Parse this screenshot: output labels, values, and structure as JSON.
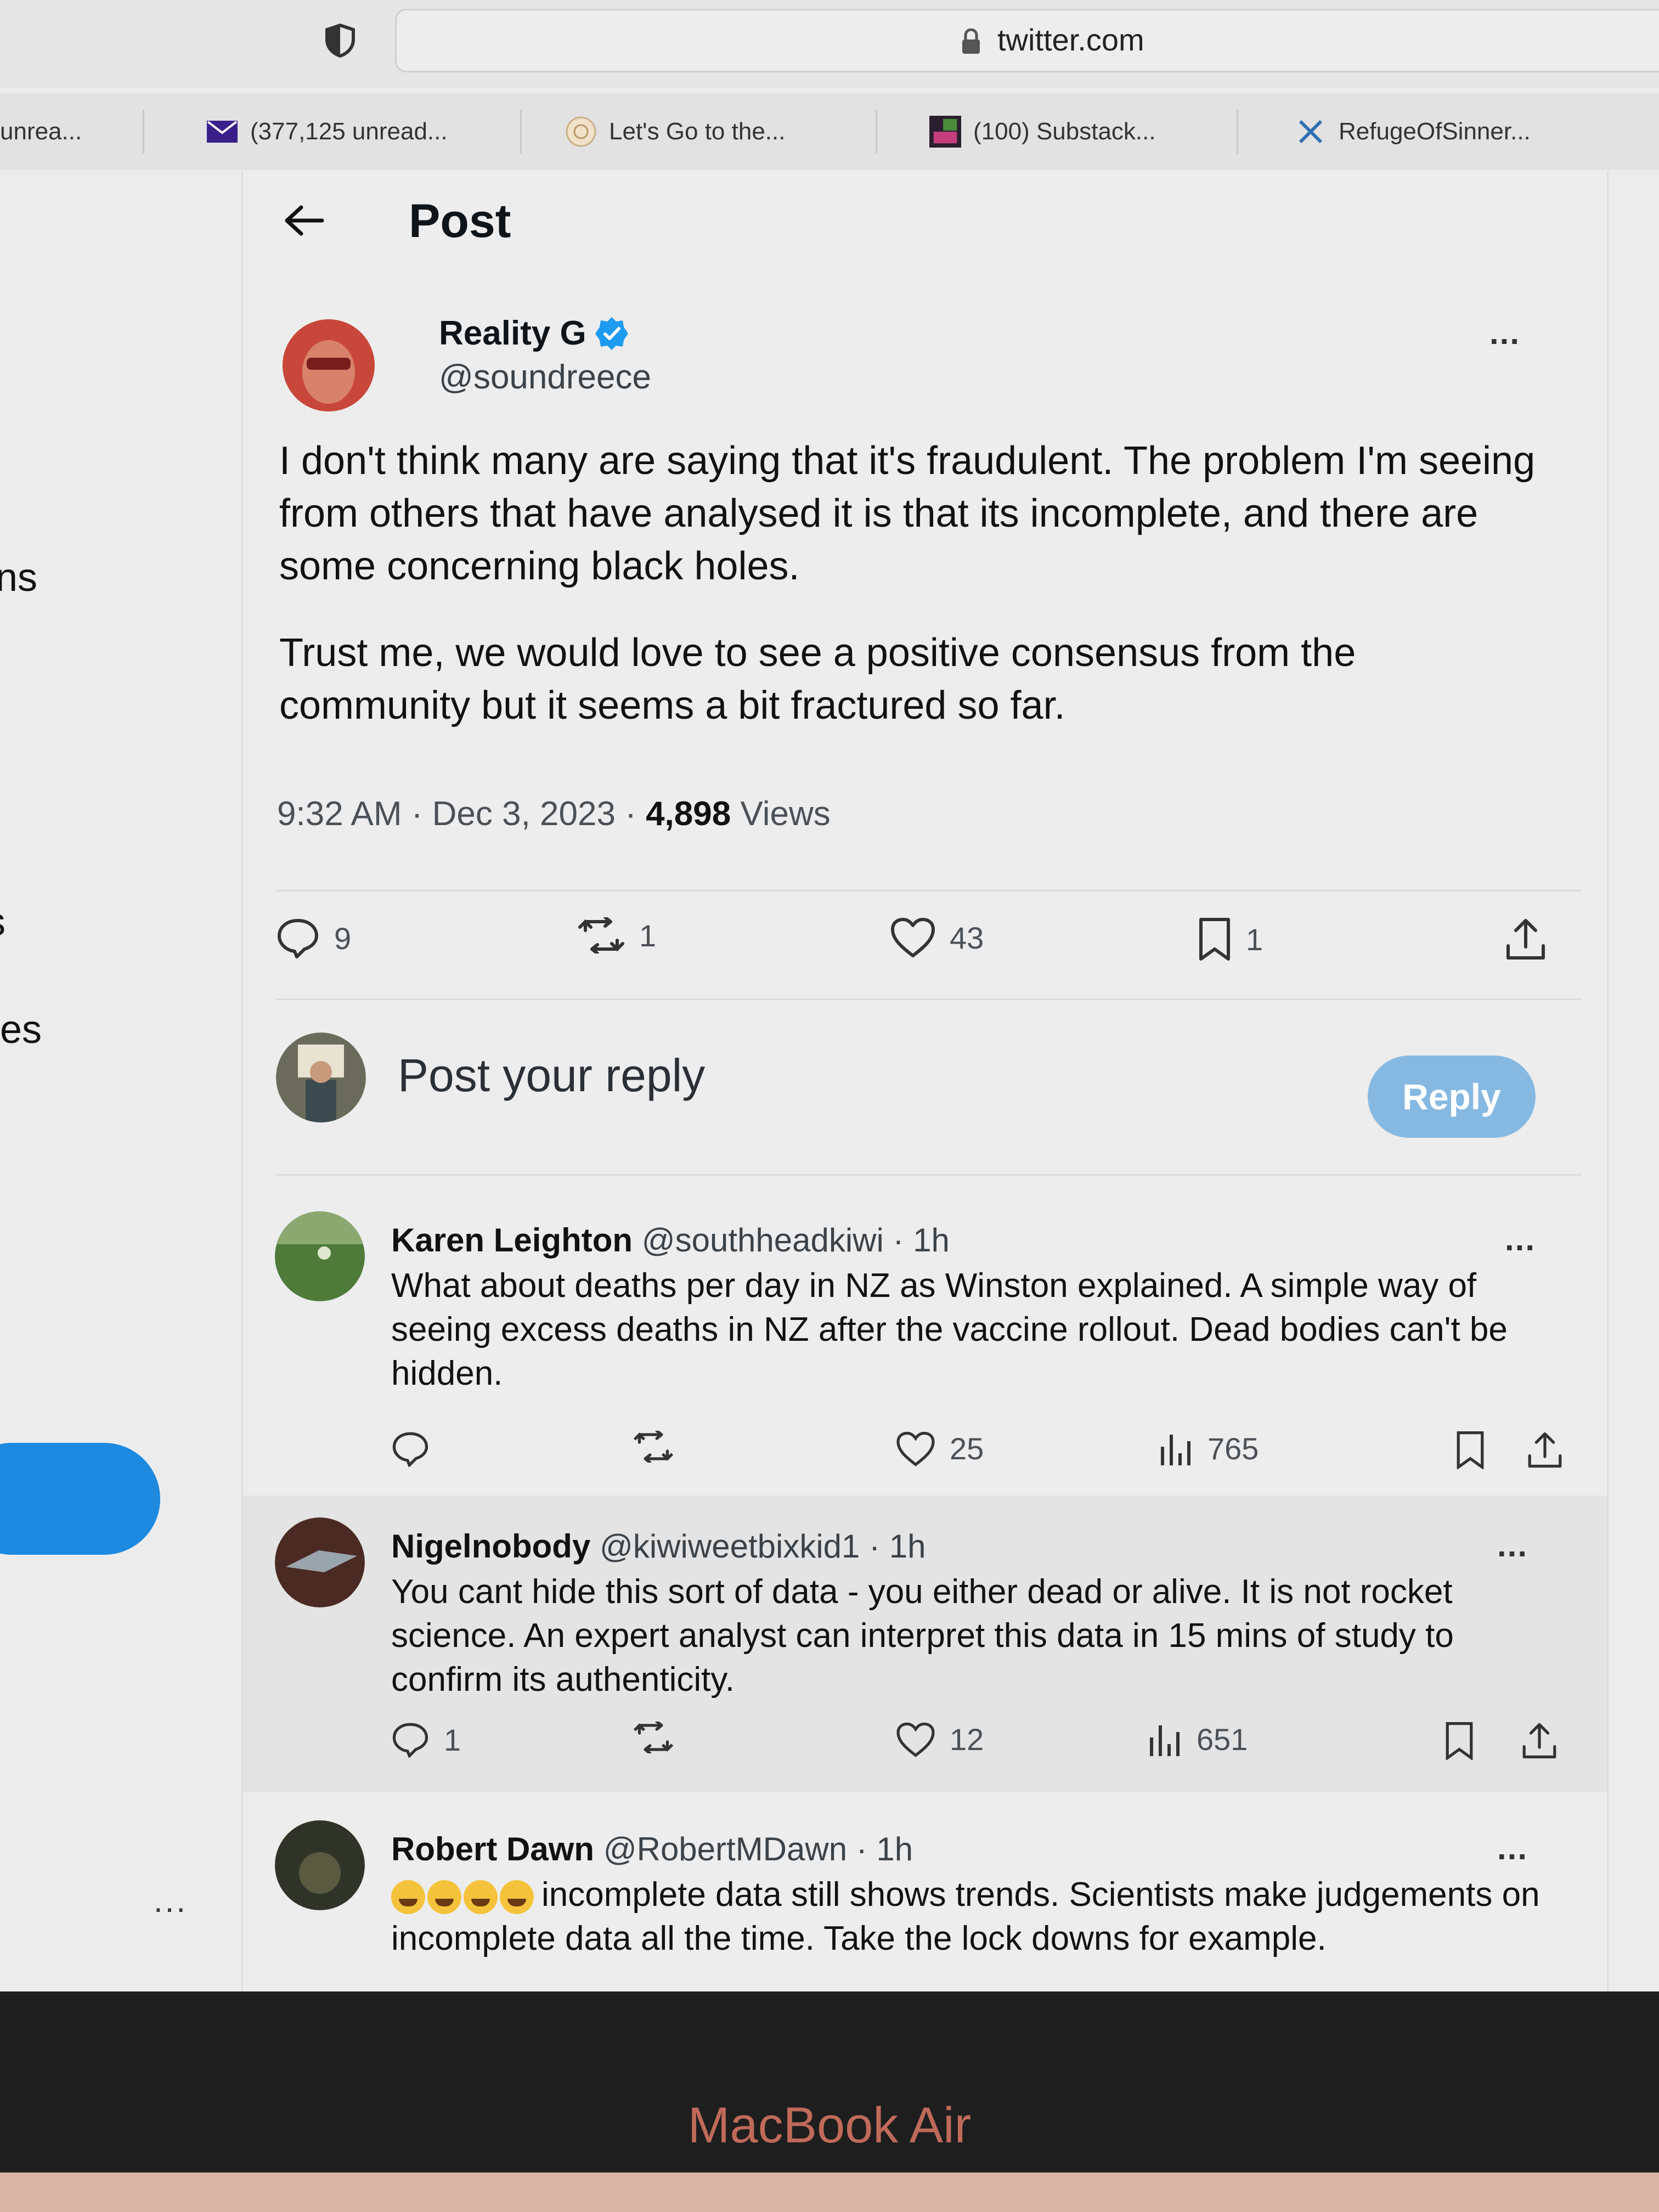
{
  "browser": {
    "domain": "twitter.com",
    "tabs": [
      {
        "label": "unrea...",
        "icon": "none"
      },
      {
        "label": "(377,125 unread...",
        "icon": "mail-icon"
      },
      {
        "label": "Let's Go to the...",
        "icon": "site-icon"
      },
      {
        "label": "(100) Substack...",
        "icon": "substack-icon"
      },
      {
        "label": "RefugeOfSinner...",
        "icon": "x-icon"
      }
    ]
  },
  "left_sidebar": {
    "partial_labels": [
      "ns",
      "s",
      "es"
    ],
    "more": "..."
  },
  "post": {
    "header_title": "Post",
    "author_name": "Reality G",
    "author_handle": "@soundreece",
    "more": "...",
    "body_p1": "I don't think many are saying that it's fraudulent. The problem I'm seeing from others that have analysed it is that its incomplete, and there are some concerning black holes.",
    "body_p2": "Trust me, we would love to see a positive consensus from the community but it seems a bit fractured so far.",
    "time": "9:32 AM",
    "sep1": "·",
    "date": "Dec 3, 2023",
    "sep2": "·",
    "views_count": "4,898",
    "views_label": "Views",
    "stats": {
      "replies": "9",
      "reposts": "1",
      "likes": "43",
      "bookmarks": "1"
    }
  },
  "reply_composer": {
    "placeholder": "Post your reply",
    "button": "Reply"
  },
  "replies": [
    {
      "name": "Karen Leighton",
      "handle": "@southheadkiwi",
      "time": "· 1h",
      "text": "What about deaths per day in NZ as Winston explained. A simple way of seeing excess deaths in NZ after the vaccine rollout. Dead bodies can't be hidden.",
      "replies": "",
      "likes": "25",
      "views": "765",
      "more": "..."
    },
    {
      "name": "Nigelnobody",
      "handle": "@kiwiweetbixkid1",
      "time": "· 1h",
      "text": "You cant hide this sort of data - you either dead or alive. It is not rocket science. An expert analyst can interpret this data in 15 mins of study to confirm its authenticity.",
      "replies": "1",
      "likes": "12",
      "views": "651",
      "more": "..."
    },
    {
      "name": "Robert Dawn",
      "handle": "@RobertMDawn",
      "time": "· 1h",
      "text": "incomplete data still shows trends. Scientists make judgements on incomplete data all the time.  Take the lock downs for example.",
      "more": "..."
    }
  ],
  "device": {
    "brand": "MacBook Air"
  },
  "colors": {
    "accent": "#1d9bf0",
    "reply_button": "#86b9e2"
  }
}
